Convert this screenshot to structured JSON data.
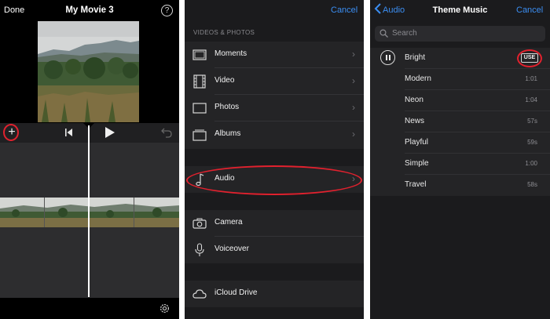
{
  "accent_color": "#3b8ef2",
  "highlight_color": "#e2212e",
  "editor": {
    "done_label": "Done",
    "title": "My Movie 3",
    "help_glyph": "?",
    "add_glyph": "+",
    "icons": [
      "help-icon",
      "add-media-icon",
      "skip-to-start-icon",
      "play-icon",
      "undo-icon",
      "settings-gear-icon"
    ]
  },
  "media_browser": {
    "cancel_label": "Cancel",
    "section_header": "VIDEOS & PHOTOS",
    "chevron": "›",
    "items": [
      {
        "label": "Moments",
        "icon": "moments-icon"
      },
      {
        "label": "Video",
        "icon": "film-icon"
      },
      {
        "label": "Photos",
        "icon": "photo-icon"
      },
      {
        "label": "Albums",
        "icon": "albums-icon"
      },
      {
        "label": "Audio",
        "icon": "music-note-icon"
      },
      {
        "label": "Camera",
        "icon": "camera-icon"
      },
      {
        "label": "Voiceover",
        "icon": "microphone-icon"
      },
      {
        "label": "iCloud Drive",
        "icon": "cloud-icon"
      }
    ]
  },
  "theme_music": {
    "back_label": "Audio",
    "title": "Theme Music",
    "cancel_label": "Cancel",
    "search_placeholder": "Search",
    "use_label": "USE",
    "tracks": [
      {
        "name": "Bright",
        "duration": ""
      },
      {
        "name": "Modern",
        "duration": "1:01"
      },
      {
        "name": "Neon",
        "duration": "1:04"
      },
      {
        "name": "News",
        "duration": "57s"
      },
      {
        "name": "Playful",
        "duration": "59s"
      },
      {
        "name": "Simple",
        "duration": "1:00"
      },
      {
        "name": "Travel",
        "duration": "58s"
      }
    ]
  }
}
